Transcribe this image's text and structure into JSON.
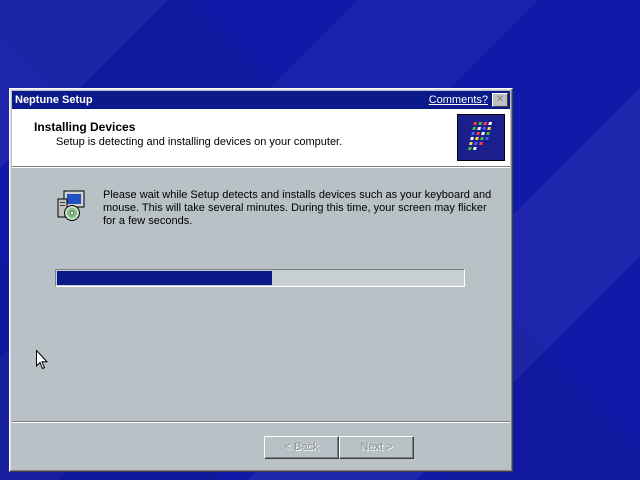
{
  "window": {
    "title": "Neptune Setup",
    "comments_link": "Comments?",
    "close_glyph": "✕"
  },
  "header": {
    "title": "Installing Devices",
    "subtitle": "Setup is detecting and installing devices on your computer.",
    "logo_icon": "windows-setup-logo-icon"
  },
  "body": {
    "icon": "setup-computer-cd-icon",
    "message": "Please wait while Setup detects and installs devices such as your keyboard and mouse.  This will take several minutes.  During this time, your screen may flicker for a few seconds."
  },
  "progress": {
    "fraction": 0.53,
    "fill_color": "#0a1a8a"
  },
  "buttons": {
    "back_label": "< Back",
    "next_label": "Next >",
    "back_enabled": false,
    "next_enabled": false
  },
  "colors": {
    "desktop": "#1019a8",
    "titlebar": "#0a1a8a",
    "dialog_face": "#b8c1c5"
  }
}
